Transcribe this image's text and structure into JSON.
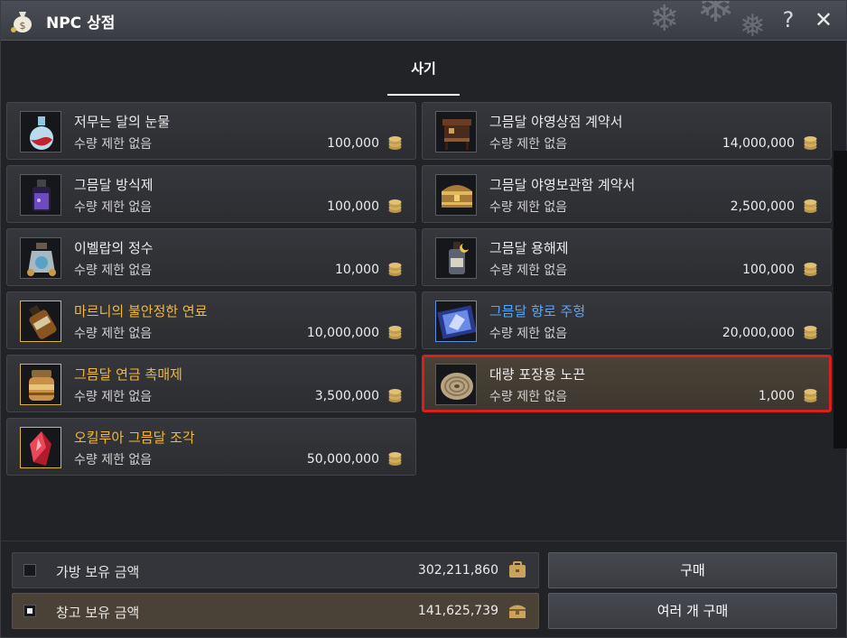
{
  "window": {
    "title": "NPC 상점",
    "help_label": "?",
    "close_label": "✕"
  },
  "tabs": [
    {
      "label": "사기",
      "active": true
    }
  ],
  "items": [
    {
      "name": "저무는 달의 눈물",
      "limit": "수량 제한 없음",
      "price": "100,000",
      "icon": "potion-flask-icon",
      "grade": "normal"
    },
    {
      "name": "그믐달 야영상점 계약서",
      "limit": "수량 제한 없음",
      "price": "14,000,000",
      "icon": "market-stall-icon",
      "grade": "normal"
    },
    {
      "name": "그믐달 방식제",
      "limit": "수량 제한 없음",
      "price": "100,000",
      "icon": "preservative-bottle-icon",
      "grade": "normal"
    },
    {
      "name": "그믐달 야영보관함 계약서",
      "limit": "수량 제한 없음",
      "price": "2,500,000",
      "icon": "storage-chest-icon",
      "grade": "normal"
    },
    {
      "name": "이벨랍의 정수",
      "limit": "수량 제한 없음",
      "price": "10,000",
      "icon": "essence-jar-icon",
      "grade": "normal"
    },
    {
      "name": "그믐달 용해제",
      "limit": "수량 제한 없음",
      "price": "100,000",
      "icon": "solvent-bottle-icon",
      "grade": "normal"
    },
    {
      "name": "마르니의 불안정한 연료",
      "limit": "수량 제한 없음",
      "price": "10,000,000",
      "icon": "fuel-bottle-icon",
      "grade": "gold"
    },
    {
      "name": "그믐달 향로 주형",
      "limit": "수량 제한 없음",
      "price": "20,000,000",
      "icon": "censer-mold-icon",
      "grade": "blue"
    },
    {
      "name": "그믐달 연금 촉매제",
      "limit": "수량 제한 없음",
      "price": "3,500,000",
      "icon": "catalyst-jar-icon",
      "grade": "gold"
    },
    {
      "name": "대량 포장용 노끈",
      "limit": "수량 제한 없음",
      "price": "1,000",
      "icon": "rope-coil-icon",
      "grade": "normal",
      "selected": true
    },
    {
      "name": "오킬루아 그믐달 조각",
      "limit": "수량 제한 없음",
      "price": "50,000,000",
      "icon": "red-crystal-icon",
      "grade": "gold"
    }
  ],
  "wallet": {
    "bag_label": "가방 보유 금액",
    "bag_amount": "302,211,860",
    "bag_checked": false,
    "storage_label": "창고 보유 금액",
    "storage_amount": "141,625,739",
    "storage_checked": true
  },
  "actions": {
    "buy_label": "구매",
    "bulk_buy_label": "여러 개 구매"
  },
  "colors": {
    "gold_grade": "#f0b93b",
    "blue_grade": "#5aa6f5",
    "selection": "#d8201f"
  }
}
